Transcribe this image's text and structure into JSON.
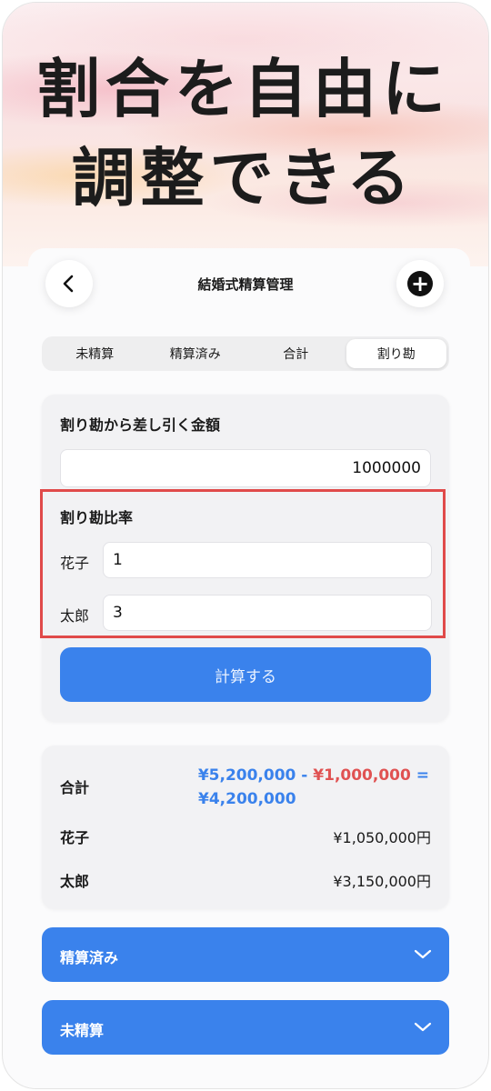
{
  "hero": {
    "line1": "割合を自由に",
    "line2": "調整できる"
  },
  "header": {
    "title": "結婚式精算管理",
    "back_icon": "chevron-left-icon",
    "add_icon": "plus-circle-icon"
  },
  "tabs": [
    {
      "label": "未精算",
      "active": false
    },
    {
      "label": "精算済み",
      "active": false
    },
    {
      "label": "合計",
      "active": false
    },
    {
      "label": "割り勘",
      "active": true
    }
  ],
  "split_form": {
    "deduct_label": "割り勘から差し引く金額",
    "deduct_value": "1000000",
    "ratio_title": "割り勘比率",
    "ratios": [
      {
        "name": "花子",
        "value": "1"
      },
      {
        "name": "太郎",
        "value": "3"
      }
    ],
    "highlight_color": "#e04a4a",
    "calc_button": "計算する"
  },
  "result": {
    "total_label": "合計",
    "formula": {
      "total": "¥5,200,000",
      "minus": "-",
      "deduct": "¥1,000,000",
      "equals": "=",
      "result": "¥4,200,000"
    },
    "rows": [
      {
        "name": "花子",
        "amount": "¥1,050,000円"
      },
      {
        "name": "太郎",
        "amount": "¥3,150,000円"
      }
    ]
  },
  "sections": [
    {
      "label": "精算済み",
      "icon": "chevron-down-icon"
    },
    {
      "label": "未精算",
      "icon": "chevron-down-icon"
    }
  ],
  "colors": {
    "accent": "#3a82ec",
    "deduct_red": "#e05252"
  }
}
